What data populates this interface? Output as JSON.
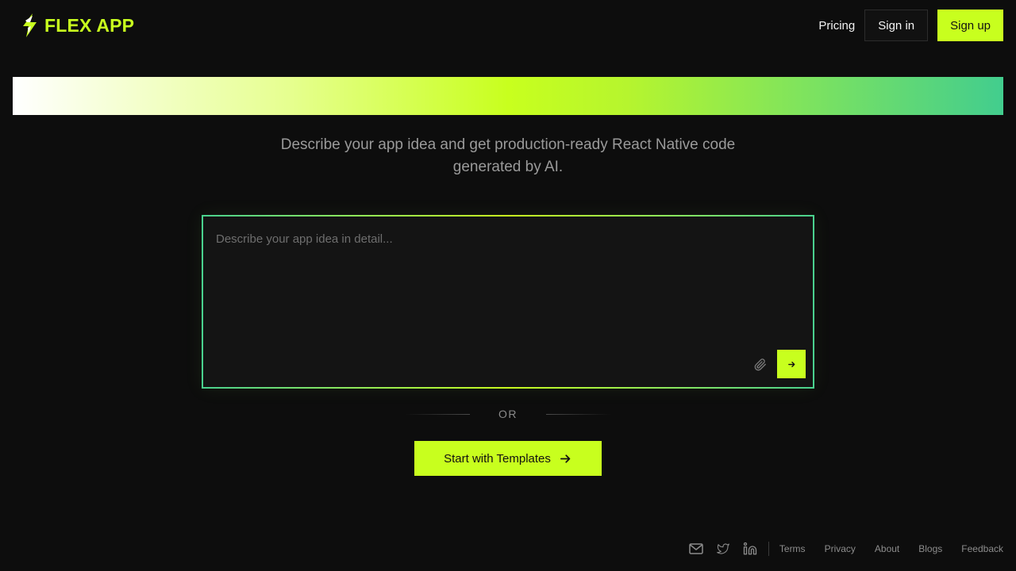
{
  "header": {
    "logo_text": "FLEX APP",
    "logo_icon": "lightning-bolt-icon",
    "nav": {
      "pricing_label": "Pricing",
      "signin_label": "Sign in",
      "signup_label": "Sign up"
    }
  },
  "hero": {
    "tagline": "Describe your app idea and get production-ready React Native code generated by AI."
  },
  "prompt": {
    "value": "",
    "placeholder": "Describe your app idea in detail...",
    "attach_icon": "paperclip-icon",
    "send_icon": "arrow-right-icon"
  },
  "divider": {
    "label": "OR"
  },
  "templates": {
    "label": "Start with Templates",
    "icon": "arrow-right-icon"
  },
  "footer": {
    "icons": [
      "mail-icon",
      "twitter-icon",
      "linkedin-icon"
    ],
    "links": [
      "Terms",
      "Privacy",
      "About",
      "Blogs",
      "Feedback"
    ]
  },
  "colors": {
    "background": "#0d0d0d",
    "accent": "#c8ff1e",
    "accent_teal": "#42cd8e",
    "surface": "#141414",
    "muted_text": "#9a9a9a"
  }
}
